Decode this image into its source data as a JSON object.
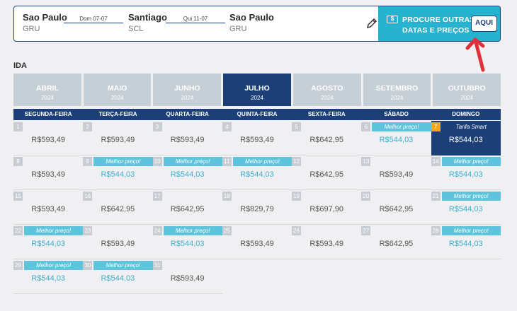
{
  "route": {
    "origin_city": "Sao Paulo",
    "origin_code": "GRU",
    "outbound_date": "Dom 07-07",
    "stopover_city": "Santiago",
    "stopover_code": "SCL",
    "return_date": "Qui 11-07",
    "destination_city": "Sao Paulo",
    "destination_code": "GRU"
  },
  "cta": {
    "icon_text": "$",
    "line1": "PROCURE OUTRAS",
    "line2": "DATAS E PREÇOS",
    "button": "AQUI"
  },
  "section_label": "IDA",
  "months": [
    {
      "name": "ABRIL",
      "year": "2024",
      "active": false
    },
    {
      "name": "MAIO",
      "year": "2024",
      "active": false
    },
    {
      "name": "JUNHO",
      "year": "2024",
      "active": false
    },
    {
      "name": "JULHO",
      "year": "2024",
      "active": true
    },
    {
      "name": "AGOSTO",
      "year": "2024",
      "active": false
    },
    {
      "name": "SETEMBRO",
      "year": "2024",
      "active": false
    },
    {
      "name": "OUTUBRO",
      "year": "2024",
      "active": false
    }
  ],
  "weekdays": [
    "SEGUNDA-FEIRA",
    "TERÇA-FEIRA",
    "QUARTA-FEIRA",
    "QUINTA-FEIRA",
    "SEXTA-FEIRA",
    "SÁBADO",
    "DOMINGO"
  ],
  "labels": {
    "best": "Melhor preço!",
    "smart": "Tarifa Smart"
  },
  "days": [
    {
      "n": "1",
      "price": "R$593,49",
      "tag": ""
    },
    {
      "n": "2",
      "price": "R$593,49",
      "tag": ""
    },
    {
      "n": "3",
      "price": "R$593,49",
      "tag": ""
    },
    {
      "n": "4",
      "price": "R$593,49",
      "tag": ""
    },
    {
      "n": "5",
      "price": "R$642,95",
      "tag": ""
    },
    {
      "n": "6",
      "price": "R$544,03",
      "tag": "best"
    },
    {
      "n": "7",
      "price": "R$544,03",
      "tag": "smart"
    },
    {
      "n": "8",
      "price": "R$593,49",
      "tag": ""
    },
    {
      "n": "9",
      "price": "R$544,03",
      "tag": "best"
    },
    {
      "n": "10",
      "price": "R$544,03",
      "tag": "best"
    },
    {
      "n": "11",
      "price": "R$544,03",
      "tag": "best"
    },
    {
      "n": "12",
      "price": "R$642,95",
      "tag": ""
    },
    {
      "n": "13",
      "price": "R$593,49",
      "tag": ""
    },
    {
      "n": "14",
      "price": "R$544,03",
      "tag": "best"
    },
    {
      "n": "15",
      "price": "R$593,49",
      "tag": ""
    },
    {
      "n": "16",
      "price": "R$642,95",
      "tag": ""
    },
    {
      "n": "17",
      "price": "R$642,95",
      "tag": ""
    },
    {
      "n": "18",
      "price": "R$829,79",
      "tag": ""
    },
    {
      "n": "19",
      "price": "R$697,90",
      "tag": ""
    },
    {
      "n": "20",
      "price": "R$642,95",
      "tag": ""
    },
    {
      "n": "21",
      "price": "R$544,03",
      "tag": "best"
    },
    {
      "n": "22",
      "price": "R$544,03",
      "tag": "best"
    },
    {
      "n": "23",
      "price": "R$593,49",
      "tag": ""
    },
    {
      "n": "24",
      "price": "R$544,03",
      "tag": "best"
    },
    {
      "n": "25",
      "price": "R$593,49",
      "tag": ""
    },
    {
      "n": "26",
      "price": "R$593,49",
      "tag": ""
    },
    {
      "n": "27",
      "price": "R$642,95",
      "tag": ""
    },
    {
      "n": "28",
      "price": "R$544,03",
      "tag": "best"
    },
    {
      "n": "29",
      "price": "R$544,03",
      "tag": "best"
    },
    {
      "n": "30",
      "price": "R$544,03",
      "tag": "best"
    },
    {
      "n": "31",
      "price": "R$593,49",
      "tag": ""
    }
  ],
  "colors": {
    "navy": "#1c3f78",
    "accent": "#27b2cf",
    "best": "#5ec4dc",
    "smart_badge": "#f2a81d",
    "arrow": "#e0303a"
  },
  "icons": {
    "edit": "pencil-icon",
    "cta": "price-tag-icon",
    "annotation": "red-arrow-icon"
  }
}
